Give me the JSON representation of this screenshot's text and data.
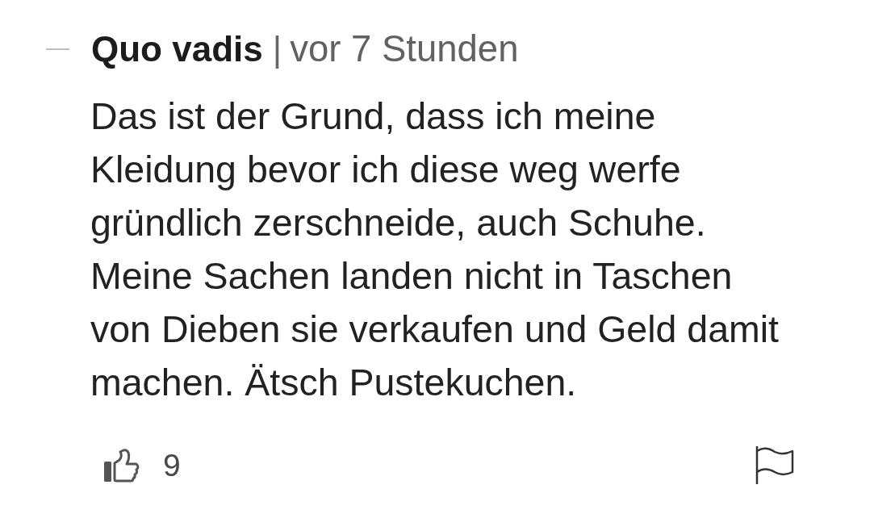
{
  "comment": {
    "author": "Quo vadis",
    "separator": "|",
    "time": "vor 7 Stunden",
    "text": "Das ist der Grund, dass ich meine Kleidung bevor ich diese weg werfe gründlich zerschneide, auch Schuhe. Meine Sachen landen nicht in Taschen von Dieben sie verkaufen und Geld damit machen. Ätsch Pustekuchen.",
    "likes": "9"
  }
}
